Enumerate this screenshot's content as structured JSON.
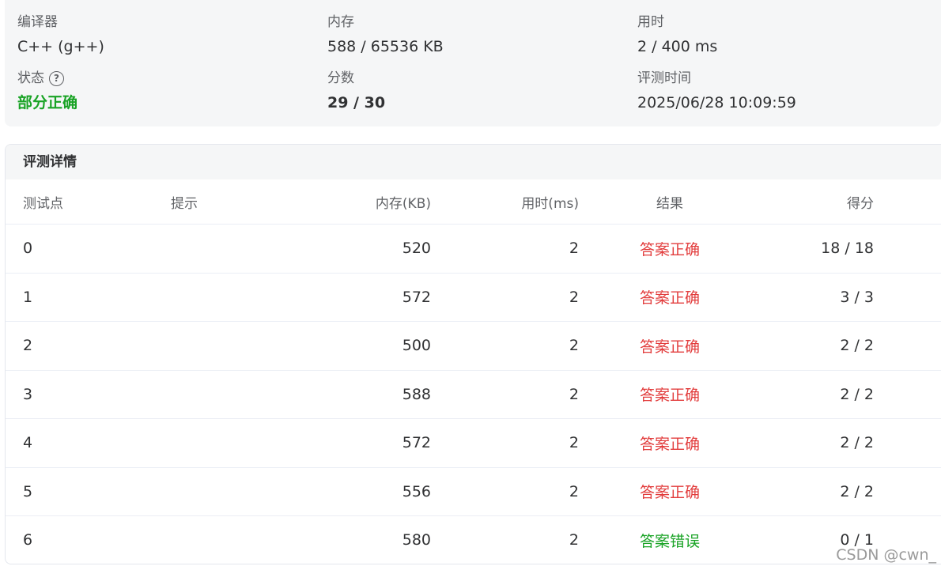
{
  "summary": {
    "compiler_label": "编译器",
    "compiler_value": "C++ (g++)",
    "memory_label": "内存",
    "memory_value": "588 / 65536 KB",
    "time_label": "用时",
    "time_value": "2 / 400 ms",
    "status_label": "状态",
    "status_value": "部分正确",
    "score_label": "分数",
    "score_value": "29 / 30",
    "judge_time_label": "评测时间",
    "judge_time_value": "2025/06/28 10:09:59",
    "help_icon_glyph": "?"
  },
  "details": {
    "title": "评测详情",
    "columns": {
      "id": "测试点",
      "hint": "提示",
      "memory": "内存(KB)",
      "time": "用时(ms)",
      "result": "结果",
      "score": "得分"
    },
    "rows": [
      {
        "id": "0",
        "hint": "",
        "memory": "520",
        "time": "2",
        "result": "答案正确",
        "score": "18 / 18"
      },
      {
        "id": "1",
        "hint": "",
        "memory": "572",
        "time": "2",
        "result": "答案正确",
        "score": "3 / 3"
      },
      {
        "id": "2",
        "hint": "",
        "memory": "500",
        "time": "2",
        "result": "答案正确",
        "score": "2 / 2"
      },
      {
        "id": "3",
        "hint": "",
        "memory": "588",
        "time": "2",
        "result": "答案正确",
        "score": "2 / 2"
      },
      {
        "id": "4",
        "hint": "",
        "memory": "572",
        "time": "2",
        "result": "答案正确",
        "score": "2 / 2"
      },
      {
        "id": "5",
        "hint": "",
        "memory": "556",
        "time": "2",
        "result": "答案正确",
        "score": "2 / 2"
      },
      {
        "id": "6",
        "hint": "",
        "memory": "580",
        "time": "2",
        "result": "答案错误",
        "score": "0 / 1"
      }
    ]
  },
  "colors": {
    "accepted": "#e23c3c",
    "wrong": "#19a325",
    "partial": "#19a325"
  },
  "watermark": "CSDN @cwn_"
}
